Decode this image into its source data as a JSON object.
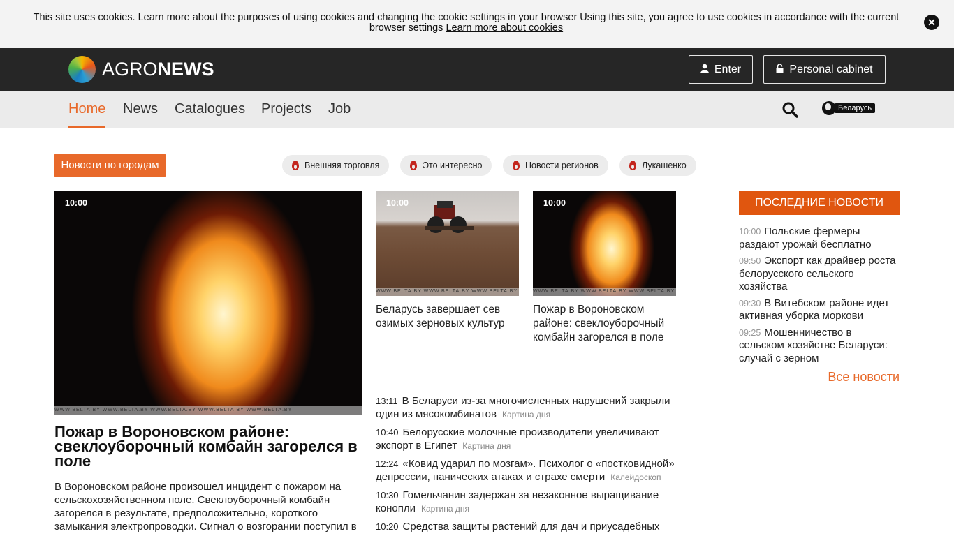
{
  "cookie": {
    "text": "This site uses cookies. Learn more about the purposes of using cookies and changing the cookie settings in your browser Using this site, you agree to use cookies in accordance with the current browser settings",
    "link": "Learn more about cookies",
    "close_icon": "close-icon"
  },
  "header": {
    "logo_agro": "AGRO",
    "logo_news": "NEWS",
    "enter_label": "Enter",
    "cabinet_label": "Personal cabinet"
  },
  "nav": {
    "items": [
      "Home",
      "News",
      "Catalogues",
      "Projects",
      "Job"
    ],
    "active": "Home",
    "region": "Беларусь"
  },
  "tags": {
    "city_button": "Новости по городам",
    "items": [
      "Внешняя торговля",
      "Это интересно",
      "Новости регионов",
      "Лукашенко"
    ]
  },
  "main_story": {
    "time": "10:00",
    "title": "Пожар в Вороновском районе: свеклоуборочный комбайн загорелся в поле",
    "lead": "В Вороновском районе произошел инцидент с пожаром на сельскохозяйственном поле. Свеклоуборочный комбайн загорелся в результате, предположительно, короткого замыкания электропроводки. Сигнал о возгорании поступил в",
    "stamp": "WWW.BELTA.BY   WWW.BELTA.BY   WWW.BELTA.BY   WWW.BELTA.BY   WWW.BELTA.BY"
  },
  "side_stories": [
    {
      "time": "10:00",
      "title": "Беларусь завершает сев озимых зерновых культур",
      "stamp": "WWW.BELTA.BY  WWW.BELTA.BY  WWW.BELTA.BY  WWW.BELTA.BY"
    },
    {
      "time": "10:00",
      "title": "Пожар в Вороновском районе: свеклоуборочный комбайн загорелся в поле",
      "stamp": "WWW.BELTA.BY  WWW.BELTA.BY  WWW.BELTA.BY  WWW.BELTA.BY"
    }
  ],
  "news_list": [
    {
      "time": "13:11",
      "title": "В Беларуси из-за многочисленных нарушений закрыли один из мясокомбинатов",
      "category": "Картина дня"
    },
    {
      "time": "10:40",
      "title": "Белорусские молочные производители увеличивают экспорт в Египет",
      "category": "Картина дня"
    },
    {
      "time": "12:24",
      "title": "«Ковид ударил по мозгам». Психолог о «постковидной» депрессии, панических атаках и страхе смерти",
      "category": "Калейдоскоп"
    },
    {
      "time": "10:30",
      "title": "Гомельчанин задержан за незаконное выращивание конопли",
      "category": "Картина дня"
    },
    {
      "time": "10:20",
      "title": "Средства защиты растений для дач и приусадебных",
      "category": ""
    }
  ],
  "latest": {
    "heading": "ПОСЛЕДНИЕ НОВОСТИ",
    "items": [
      {
        "time": "10:00",
        "title": "Польские фермеры раздают урожай бесплатно"
      },
      {
        "time": "09:50",
        "title": "Экспорт как драйвер роста белорусского сельского хозяйства"
      },
      {
        "time": "09:30",
        "title": "В Витебском районе идет активная уборка моркови"
      },
      {
        "time": "09:25",
        "title": "Мошенничество в сельском хозяйстве Беларуси: случай с зерном"
      }
    ],
    "all_news": "Все новости"
  },
  "colors": {
    "accent": "#e8692a",
    "latest_header": "#e0560f",
    "header_bg": "#262626",
    "nav_bg": "#ebebeb",
    "cookie_bg": "#f3f3f3"
  }
}
